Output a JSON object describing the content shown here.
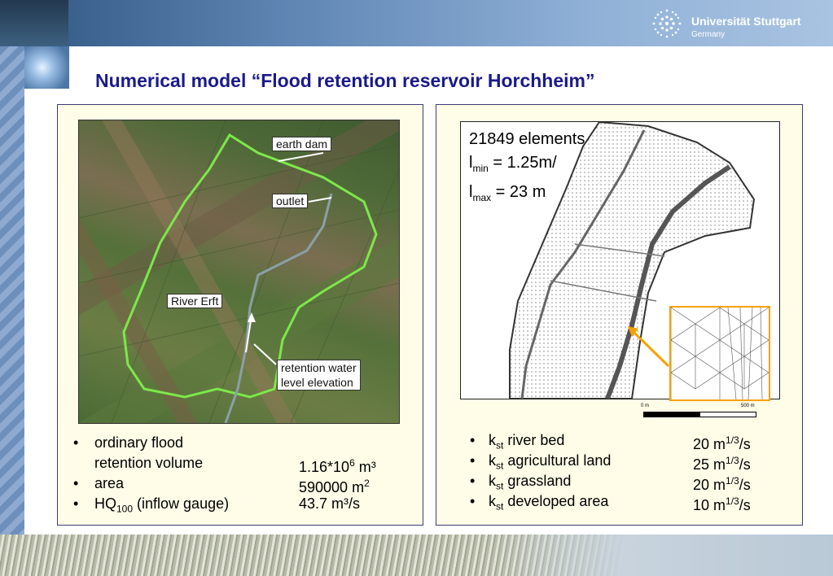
{
  "header": {
    "university": "Universität Stuttgart",
    "country": "Germany"
  },
  "slide_title": "Numerical model “Flood retention reservoir Horchheim”",
  "photo_labels": {
    "earth_dam": "earth dam",
    "outlet": "outlet",
    "river_erft": "River Erft",
    "retention_line1": "retention water",
    "retention_line2": "level elevation"
  },
  "mesh": {
    "elements": "21849 elements",
    "lmin_prefix": "l",
    "lmin_sub": "min",
    "lmin_value": " = 1.25m/",
    "lmax_prefix": "l",
    "lmax_sub": "max",
    "lmax_value": " = 23 m",
    "scale_start": "0 m",
    "scale_end": "500 m"
  },
  "left_bullets": {
    "bullet": "•",
    "item1_line1": "ordinary flood",
    "item1_line2": "retention volume",
    "item1_value": "1.16*10",
    "item1_exp": "6",
    "item1_unit": " m³",
    "item2_label": "area",
    "item2_value": "590000 m",
    "item2_exp": "2",
    "item3_label_a": "HQ",
    "item3_label_sub": "100",
    "item3_label_b": " (inflow gauge)",
    "item3_value": "43.7 m³/s"
  },
  "right_bullets": [
    {
      "k": "k",
      "sub": "st",
      "label": " river bed",
      "value": "20 m",
      "exp": "1/3",
      "unit": "/s"
    },
    {
      "k": "k",
      "sub": "st",
      "label": " agricultural land",
      "value": "25 m",
      "exp": "1/3",
      "unit": "/s"
    },
    {
      "k": "k",
      "sub": "st",
      "label": " grassland",
      "value": "20 m",
      "exp": "1/3",
      "unit": "/s"
    },
    {
      "k": "k",
      "sub": "st",
      "label": " developed area",
      "value": "10 m",
      "exp": "1/3",
      "unit": "/s"
    }
  ],
  "colors": {
    "title": "#1a1a8c",
    "inset_border": "#f5a200",
    "boundary_line": "#7de84a"
  }
}
